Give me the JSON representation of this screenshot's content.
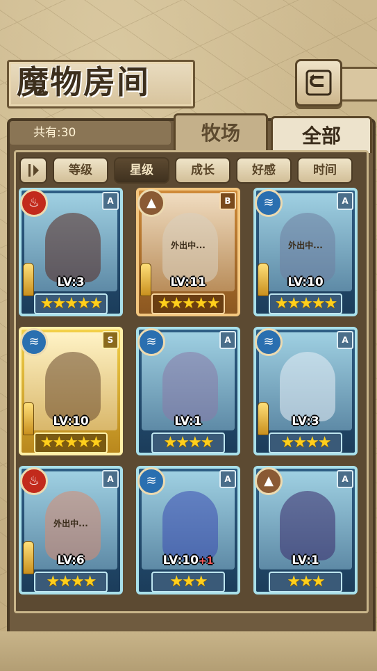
{
  "header": {
    "title": "魔物房间",
    "back_icon": "return-arrow-icon"
  },
  "tabs": [
    {
      "label": "牧场",
      "active": false
    },
    {
      "label": "全部",
      "active": true
    }
  ],
  "count_label": "共有:30",
  "filters": [
    {
      "label": "等级",
      "active": false
    },
    {
      "label": "星级",
      "active": true
    },
    {
      "label": "成长",
      "active": false
    },
    {
      "label": "好感",
      "active": false
    },
    {
      "label": "时间",
      "active": false
    }
  ],
  "monsters": [
    {
      "element": "fire",
      "rank": "A",
      "frame": "blue",
      "level": "LV:3",
      "stars": "★★★★★",
      "away": ""
    },
    {
      "element": "earth",
      "rank": "B",
      "frame": "bronze",
      "level": "LV:11",
      "stars": "★★★★★",
      "away": "外出中..."
    },
    {
      "element": "water",
      "rank": "A",
      "frame": "blue",
      "level": "LV:10",
      "stars": "★★★★★",
      "away": "外出中..."
    },
    {
      "element": "water",
      "rank": "S",
      "frame": "gold",
      "level": "LV:10",
      "stars": "★★★★★",
      "away": ""
    },
    {
      "element": "water",
      "rank": "A",
      "frame": "blue",
      "level": "LV:1",
      "stars": "★★★★",
      "away": ""
    },
    {
      "element": "water",
      "rank": "A",
      "frame": "blue",
      "level": "LV:3",
      "stars": "★★★★",
      "away": ""
    },
    {
      "element": "fire",
      "rank": "A",
      "frame": "blue",
      "level": "LV:6",
      "stars": "★★★★",
      "away": "外出中..."
    },
    {
      "element": "water",
      "rank": "A",
      "frame": "blue",
      "level": "LV:10",
      "level_bonus": "+1",
      "stars": "★★★",
      "away": ""
    },
    {
      "element": "earth",
      "rank": "A",
      "frame": "blue",
      "level": "LV:1",
      "stars": "★★★",
      "away": ""
    }
  ]
}
